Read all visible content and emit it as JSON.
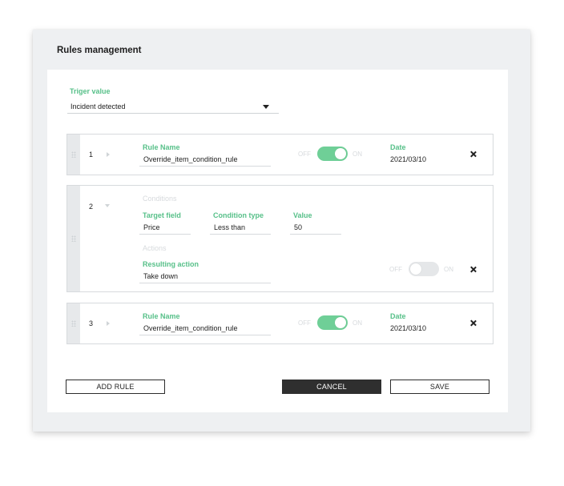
{
  "title": "Rules management",
  "trigger": {
    "label": "Triger value",
    "selected": "Incident detected"
  },
  "rules": [
    {
      "number": "1",
      "name_label": "Rule Name",
      "name_value": "Override_item_condition_rule",
      "toggle_off": "OFF",
      "toggle_on": "ON",
      "enabled": true,
      "date_label": "Date",
      "date_value": "2021/03/10"
    },
    {
      "number": "2",
      "conditions_label": "Conditions",
      "target_field_label": "Target field",
      "target_field_value": "Price",
      "condition_type_label": "Condition type",
      "condition_type_value": "Less than",
      "value_label": "Value",
      "value_value": "50",
      "actions_label": "Actions",
      "resulting_action_label": "Resulting action",
      "resulting_action_value": "Take down",
      "toggle_off": "OFF",
      "toggle_on": "ON",
      "enabled": false
    },
    {
      "number": "3",
      "name_label": "Rule Name",
      "name_value": "Override_item_condition_rule",
      "toggle_off": "OFF",
      "toggle_on": "ON",
      "enabled": true,
      "date_label": "Date",
      "date_value": "2021/03/10"
    }
  ],
  "buttons": {
    "add_rule": "ADD RULE",
    "cancel": "CANCEL",
    "save": "SAVE"
  },
  "colors": {
    "accent": "#57c089",
    "toggle_on": "#6fcf97",
    "dark_button": "#2f2f2f"
  }
}
